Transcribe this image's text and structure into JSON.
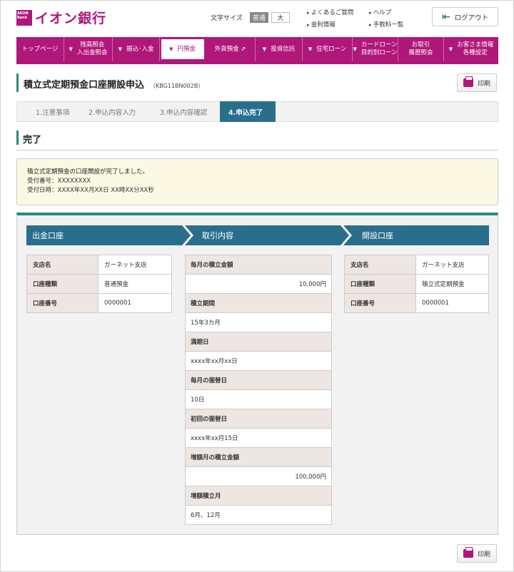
{
  "header": {
    "logo_text": "イオン銀行",
    "logo_mark": "AEON Bank",
    "fontsize_label": "文字サイズ",
    "fontsize_normal": "普通",
    "fontsize_large": "大",
    "links_col1": [
      "よくあるご質問",
      "金利情報"
    ],
    "links_col2": [
      "ヘルプ",
      "手数料一覧"
    ],
    "logout_label": "ログアウト"
  },
  "nav": {
    "items": [
      {
        "label": "トップページ",
        "caret": false
      },
      {
        "label": "残高照会\n入出金照会",
        "caret": true
      },
      {
        "label": "振込･入金",
        "caret": true
      },
      {
        "label": "円預金",
        "caret": true,
        "active": true
      },
      {
        "label": "外貨預金 ⇗",
        "caret": false
      },
      {
        "label": "投資信託",
        "caret": true
      },
      {
        "label": "住宅ローン",
        "caret": true
      },
      {
        "label": "カードローン\n目的別ローン",
        "caret": true
      },
      {
        "label": "お取引\n履歴照会",
        "caret": false
      },
      {
        "label": "お客さま情報\n各種設定",
        "caret": true
      }
    ]
  },
  "page": {
    "title": "積立式定期預金口座開設申込",
    "code": "（KBG11BN002B）",
    "print_label": "印刷"
  },
  "steps": [
    "1.注意事項",
    "2.申込内容入力",
    "3.申込内容確認",
    "4.申込完了"
  ],
  "section": {
    "title": "完了"
  },
  "notice": {
    "line1": "積立式定期預金の口座開設が完了しました。",
    "line2": "受付番号：XXXXXXXX",
    "line3": "受付日時：XXXX年XX月XX日 XX時XX分XX秒"
  },
  "withdrawal": {
    "heading": "出金口座",
    "rows": [
      {
        "key": "支店名",
        "value": "ガーネット支店"
      },
      {
        "key": "口座種類",
        "value": "普通預金"
      },
      {
        "key": "口座番号",
        "value": "0000001"
      }
    ]
  },
  "transaction": {
    "heading": "取引内容",
    "rows": [
      {
        "key": "毎月の積立金額",
        "value": "10,000円",
        "right": true
      },
      {
        "key": "積立期間",
        "value": "15年3カ月",
        "right": false
      },
      {
        "key": "満期日",
        "value": "xxxx年xx月xx日",
        "right": false
      },
      {
        "key": "毎月の振替日",
        "value": "10日",
        "right": false
      },
      {
        "key": "初回の振替日",
        "value": "xxxx年xx月15日",
        "right": false
      },
      {
        "key": "増額月の積立金額",
        "value": "100,000円",
        "right": true
      },
      {
        "key": "増額積立月",
        "value": "6月、12月",
        "right": false
      }
    ]
  },
  "opening": {
    "heading": "開設口座",
    "rows": [
      {
        "key": "支店名",
        "value": "ガーネット支店"
      },
      {
        "key": "口座種類",
        "value": "積立式定期預金"
      },
      {
        "key": "口座番号",
        "value": "0000001"
      }
    ]
  },
  "colors": {
    "brand": "#b0177a",
    "accent": "#2a8a7e",
    "step_active": "#2a6e8e",
    "notice_bg": "#fbf8e4"
  }
}
